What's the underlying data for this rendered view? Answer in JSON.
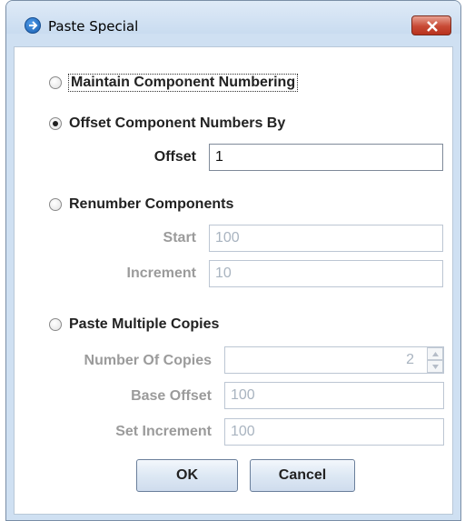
{
  "window": {
    "title": "Paste Special",
    "close_label": "x"
  },
  "options": {
    "maintain": {
      "label": "Maintain Component Numbering",
      "checked": false
    },
    "offset": {
      "label": "Offset Component Numbers By",
      "checked": true
    },
    "renumber": {
      "label": "Renumber Components",
      "checked": false
    },
    "multiple": {
      "label": "Paste Multiple Copies",
      "checked": false
    }
  },
  "offset_field": {
    "label": "Offset",
    "value": "1"
  },
  "renumber_fields": {
    "start_label": "Start",
    "start_value": "100",
    "increment_label": "Increment",
    "increment_value": "10"
  },
  "multiple_fields": {
    "copies_label": "Number Of Copies",
    "copies_value": "2",
    "base_label": "Base Offset",
    "base_value": "100",
    "set_inc_label": "Set Increment",
    "set_inc_value": "100"
  },
  "buttons": {
    "ok": "OK",
    "cancel": "Cancel"
  }
}
